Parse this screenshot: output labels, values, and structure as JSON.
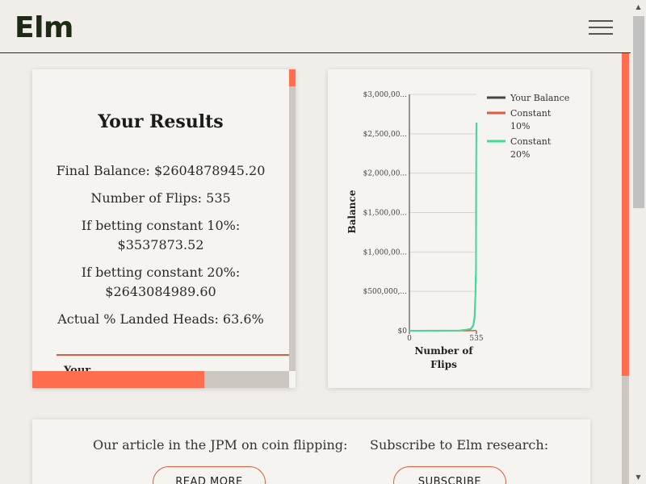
{
  "header": {
    "logo": "Elm"
  },
  "results": {
    "title": "Your Results",
    "final_balance": "Final Balance: $2604878945.20",
    "num_flips": "Number of Flips: 535",
    "const10_label": "If betting constant 10%:",
    "const10_value": "$3537873.52",
    "const20_label": "If betting constant 20%:",
    "const20_value": "$2643084989.60",
    "landed_heads": "Actual % Landed Heads: 63.6%",
    "next_section": "Your"
  },
  "chart_data": {
    "type": "line",
    "xlabel": "Number of Flips",
    "ylabel": "Balance",
    "xlim": [
      0,
      535
    ],
    "ylim": [
      0,
      3000000000
    ],
    "x_ticks": [
      "0",
      "535"
    ],
    "y_ticks": [
      "$0",
      "$500,000,...",
      "$1,000,00...",
      "$1,500,00...",
      "$2,000,00...",
      "$2,500,00...",
      "$3,000,00..."
    ],
    "y_tick_values": [
      0,
      500000000,
      1000000000,
      1500000000,
      2000000000,
      2500000000,
      3000000000
    ],
    "grid": true,
    "legend_position": "right",
    "series": [
      {
        "name": "Your Balance",
        "color": "#444444",
        "x": [
          0,
          400,
          450,
          490,
          510,
          520,
          525,
          528,
          530,
          532,
          533,
          534,
          535
        ],
        "y": [
          1000,
          3000000,
          10000000,
          20000000,
          60000000,
          150000000,
          300000000,
          500000000,
          700000000,
          1500000000,
          2000000000,
          2400000000,
          2604878945
        ]
      },
      {
        "name": "Constant 10%",
        "color": "#e9573a",
        "x": [
          0,
          300,
          450,
          500,
          520,
          535
        ],
        "y": [
          1000,
          100000,
          500000,
          1200000,
          2000000,
          3537873
        ]
      },
      {
        "name": "Constant 20%",
        "color": "#3ddc97",
        "x": [
          0,
          400,
          450,
          490,
          510,
          520,
          524,
          527,
          529,
          531,
          533,
          534,
          535
        ],
        "y": [
          1000,
          3000000,
          12000000,
          25000000,
          70000000,
          180000000,
          350000000,
          450000000,
          700000000,
          600000000,
          1800000000,
          2300000000,
          2643084989
        ]
      }
    ]
  },
  "bottom": {
    "article_text": "Our article in the JPM on coin flipping:",
    "read_more_label": "READ MORE",
    "subscribe_text": "Subscribe to Elm research:",
    "subscribe_label": "SUBSCRIBE"
  },
  "colors": {
    "accent": "#ff6f4f",
    "background": "#f1eeea",
    "card": "#f6f4f1"
  }
}
